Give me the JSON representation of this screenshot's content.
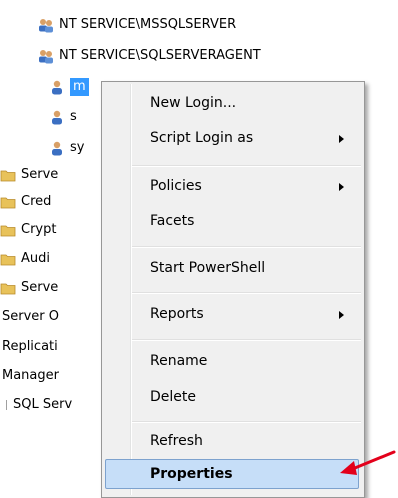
{
  "tree": {
    "items": [
      {
        "label": "NT SERVICE\\MSSQLSERVER",
        "icon": "group-icon"
      },
      {
        "label": "NT SERVICE\\SQLSERVERAGENT",
        "icon": "group-icon"
      },
      {
        "label": "m",
        "icon": "user-icon"
      },
      {
        "label": "s",
        "icon": "user-icon"
      },
      {
        "label": "sy",
        "icon": "user-icon"
      },
      {
        "label": "Serve",
        "icon": "folder-icon"
      },
      {
        "label": "Cred",
        "icon": "folder-icon"
      },
      {
        "label": "Crypt",
        "icon": "folder-icon"
      },
      {
        "label": "Audi",
        "icon": "folder-icon"
      },
      {
        "label": "Serve",
        "icon": "folder-icon"
      },
      {
        "label": "Server O",
        "icon": ""
      },
      {
        "label": "Replicati",
        "icon": ""
      },
      {
        "label": "Manager",
        "icon": ""
      },
      {
        "label": "SQL Serv",
        "icon": ""
      }
    ]
  },
  "context_menu": {
    "items": [
      {
        "label": "New Login...",
        "submenu": false
      },
      {
        "label": "Script Login as",
        "submenu": true
      },
      {
        "label": "Policies",
        "submenu": true
      },
      {
        "label": "Facets",
        "submenu": false
      },
      {
        "label": "Start PowerShell",
        "submenu": false
      },
      {
        "label": "Reports",
        "submenu": true
      },
      {
        "label": "Rename",
        "submenu": false
      },
      {
        "label": "Delete",
        "submenu": false
      },
      {
        "label": "Refresh",
        "submenu": false
      },
      {
        "label": "Properties",
        "submenu": false,
        "highlighted": true
      }
    ]
  },
  "colors": {
    "selection": "#3399ff",
    "menu_highlight": "#c6def8",
    "annotation_arrow": "#e3001b",
    "folder": "#e8c25a"
  }
}
